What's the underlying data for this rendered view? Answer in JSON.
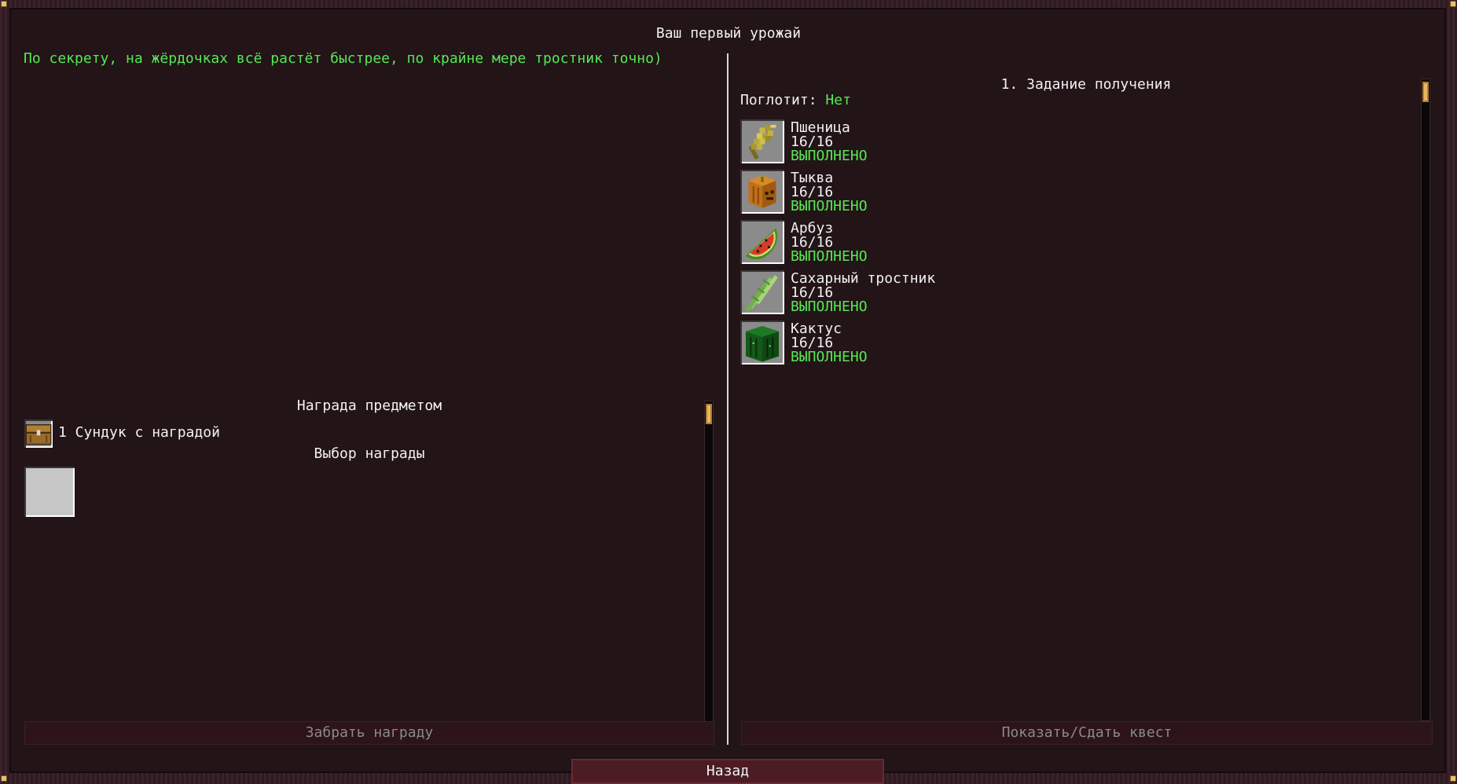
{
  "quest": {
    "title": "Ваш первый урожай",
    "description": "По секрету, на жёрдочках всё растёт быстрее, по крайне мере тростник точно)"
  },
  "rewards": {
    "item_reward_header": "Награда предметом",
    "item_reward_label": "1 Сундук с наградой",
    "choice_header": "Выбор награды",
    "claim_button": "Забрать награду"
  },
  "tasks": {
    "header": "1. Задание получения",
    "consume_label": "Поглотит:",
    "consume_value": "Нет",
    "items": [
      {
        "name": "Пшеница",
        "count": "16/16",
        "status": "ВЫПОЛНЕНО",
        "icon": "wheat-icon"
      },
      {
        "name": "Тыква",
        "count": "16/16",
        "status": "ВЫПОЛНЕНО",
        "icon": "pumpkin-icon"
      },
      {
        "name": "Арбуз",
        "count": "16/16",
        "status": "ВЫПОЛНЕНО",
        "icon": "melon-slice-icon"
      },
      {
        "name": "Сахарный тростник",
        "count": "16/16",
        "status": "ВЫПОЛНЕНО",
        "icon": "sugar-cane-icon"
      },
      {
        "name": "Кактус",
        "count": "16/16",
        "status": "ВЫПОЛНЕНО",
        "icon": "cactus-icon"
      }
    ],
    "submit_button": "Показать/Сдать квест"
  },
  "navigation": {
    "back_button": "Назад"
  },
  "colors": {
    "background": "#221417",
    "completed": "#55e855",
    "scroll_thumb": "#e8b860"
  }
}
